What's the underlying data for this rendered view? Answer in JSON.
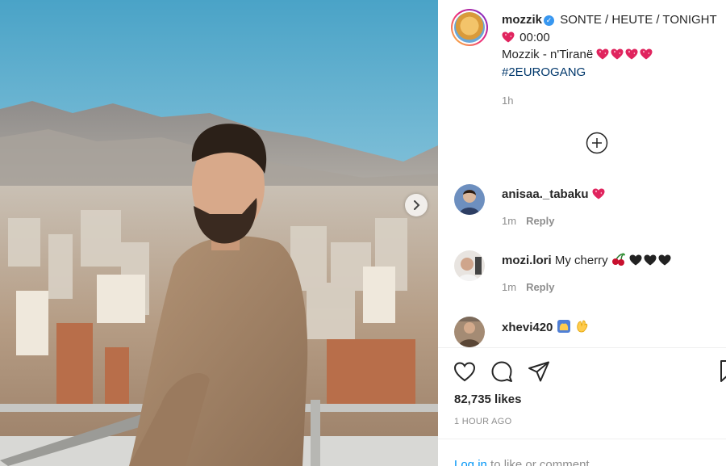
{
  "post": {
    "username": "mozzik",
    "caption_line1": "SONTE / HEUTE / TONIGHT",
    "caption_time": "00:00",
    "caption_line3": "Mozzik - n'Tiranë",
    "hashtag": "#2EUROGANG",
    "posted_short": "1h"
  },
  "comments": [
    {
      "username": "anisaa._tabaku",
      "text": "",
      "time": "1m",
      "reply_label": "Reply"
    },
    {
      "username": "mozi.lori",
      "text": "My cherry",
      "time": "1m",
      "reply_label": "Reply"
    },
    {
      "username": "xhevi420",
      "text": "",
      "time": "",
      "reply_label": ""
    }
  ],
  "actions": {
    "likes": "82,735 likes",
    "posted_ago": "1 HOUR AGO",
    "login_link": "Log in",
    "login_suffix": " to like or comment."
  },
  "icons": {
    "verified": "verified-badge-icon",
    "heart_emoji": "sparkling-heart-icon",
    "load_more": "plus-circle-icon",
    "cherry": "cherries-icon",
    "black_heart": "black-heart-icon",
    "next": "chevron-right-icon",
    "like": "heart-outline-icon",
    "comment": "speech-bubble-icon",
    "share": "paper-plane-icon",
    "save": "bookmark-icon"
  },
  "colors": {
    "link_blue": "#0095f6",
    "hashtag": "#00376b",
    "muted": "#8e8e8e",
    "text": "#262626",
    "verified": "#3897f0",
    "heart_emoji": "#e0245e"
  }
}
